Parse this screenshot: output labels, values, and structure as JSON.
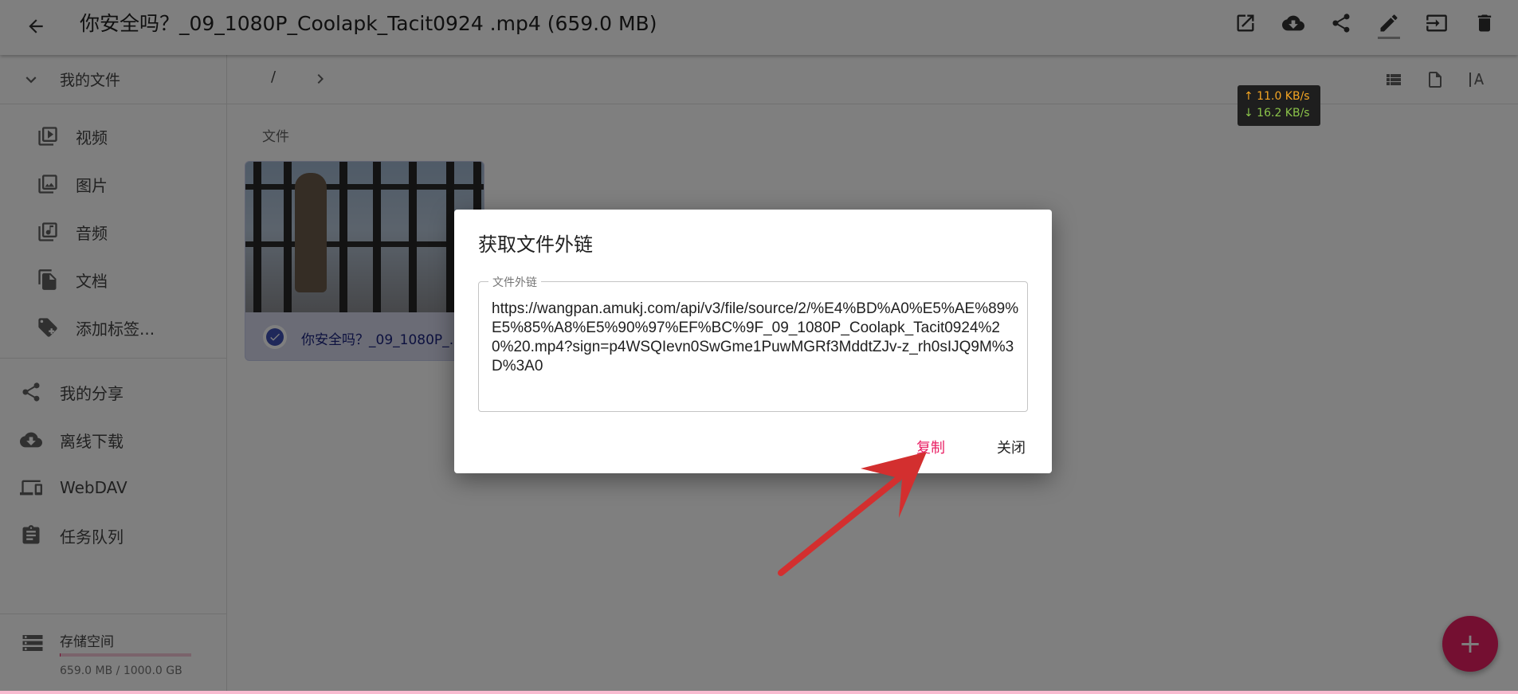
{
  "appbar": {
    "title": "你安全吗？_09_1080P_Coolapk_Tacit0924 .mp4 (659.0 MB)",
    "actions": [
      "open-external-icon",
      "download-cloud-icon",
      "share-icon",
      "edit-icon",
      "move-icon",
      "delete-icon"
    ]
  },
  "sidebar": {
    "header": "我的文件",
    "items": [
      {
        "label": "视频",
        "icon": "video-icon"
      },
      {
        "label": "图片",
        "icon": "image-icon"
      },
      {
        "label": "音频",
        "icon": "audio-icon"
      },
      {
        "label": "文档",
        "icon": "document-icon"
      },
      {
        "label": "添加标签...",
        "icon": "add-tag-icon"
      }
    ],
    "items2": [
      {
        "label": "我的分享",
        "icon": "share-icon"
      },
      {
        "label": "离线下载",
        "icon": "cloud-download-icon"
      },
      {
        "label": "WebDAV",
        "icon": "devices-icon"
      },
      {
        "label": "任务队列",
        "icon": "clipboard-icon"
      }
    ],
    "storage": {
      "label": "存储空间",
      "usage": "659.0 MB / 1000.0 GB",
      "fraction": 0.00066
    }
  },
  "breadcrumb": {
    "root": "/"
  },
  "main": {
    "section_label": "文件",
    "file": {
      "name": "你安全吗？_09_1080P_Coolapk_Tacit0924 .mp4",
      "selected": true
    }
  },
  "speed": {
    "up": "↑ 11.0 KB/s",
    "down": "↓ 16.2 KB/s"
  },
  "fab": {
    "label": "+"
  },
  "dialog": {
    "title": "获取文件外链",
    "field_label": "文件外链",
    "url": "https://wangpan.amukj.com/api/v3/file/source/2/%E4%BD%A0%E5%AE%89%E5%85%A8%E5%90%97%EF%BC%9F_09_1080P_Coolapk_Tacit0924%20%20.mp4?sign=p4WSQIevn0SwGme1PuwMGRf3MddtZJv-z_rh0sIJQ9M%3D%3A0",
    "copy_label": "复制",
    "close_label": "关闭"
  },
  "colors": {
    "accent": "#e91e63",
    "primary": "#3f51b5",
    "annotation_arrow": "#d32f2f"
  }
}
